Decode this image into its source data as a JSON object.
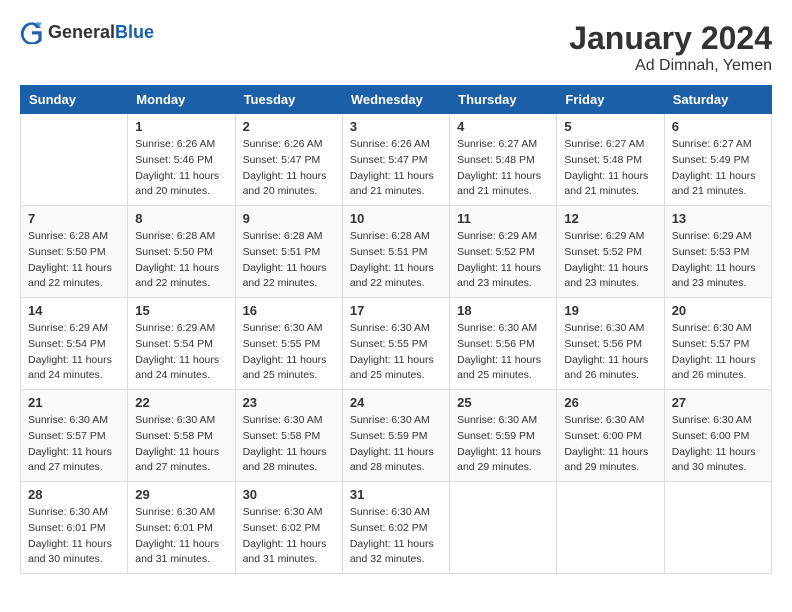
{
  "header": {
    "logo_general": "General",
    "logo_blue": "Blue",
    "month": "January 2024",
    "location": "Ad Dimnah, Yemen"
  },
  "days_of_week": [
    "Sunday",
    "Monday",
    "Tuesday",
    "Wednesday",
    "Thursday",
    "Friday",
    "Saturday"
  ],
  "weeks": [
    [
      {
        "day": "",
        "info": ""
      },
      {
        "day": "1",
        "info": "Sunrise: 6:26 AM\nSunset: 5:46 PM\nDaylight: 11 hours\nand 20 minutes."
      },
      {
        "day": "2",
        "info": "Sunrise: 6:26 AM\nSunset: 5:47 PM\nDaylight: 11 hours\nand 20 minutes."
      },
      {
        "day": "3",
        "info": "Sunrise: 6:26 AM\nSunset: 5:47 PM\nDaylight: 11 hours\nand 21 minutes."
      },
      {
        "day": "4",
        "info": "Sunrise: 6:27 AM\nSunset: 5:48 PM\nDaylight: 11 hours\nand 21 minutes."
      },
      {
        "day": "5",
        "info": "Sunrise: 6:27 AM\nSunset: 5:48 PM\nDaylight: 11 hours\nand 21 minutes."
      },
      {
        "day": "6",
        "info": "Sunrise: 6:27 AM\nSunset: 5:49 PM\nDaylight: 11 hours\nand 21 minutes."
      }
    ],
    [
      {
        "day": "7",
        "info": "Sunrise: 6:28 AM\nSunset: 5:50 PM\nDaylight: 11 hours\nand 22 minutes."
      },
      {
        "day": "8",
        "info": "Sunrise: 6:28 AM\nSunset: 5:50 PM\nDaylight: 11 hours\nand 22 minutes."
      },
      {
        "day": "9",
        "info": "Sunrise: 6:28 AM\nSunset: 5:51 PM\nDaylight: 11 hours\nand 22 minutes."
      },
      {
        "day": "10",
        "info": "Sunrise: 6:28 AM\nSunset: 5:51 PM\nDaylight: 11 hours\nand 22 minutes."
      },
      {
        "day": "11",
        "info": "Sunrise: 6:29 AM\nSunset: 5:52 PM\nDaylight: 11 hours\nand 23 minutes."
      },
      {
        "day": "12",
        "info": "Sunrise: 6:29 AM\nSunset: 5:52 PM\nDaylight: 11 hours\nand 23 minutes."
      },
      {
        "day": "13",
        "info": "Sunrise: 6:29 AM\nSunset: 5:53 PM\nDaylight: 11 hours\nand 23 minutes."
      }
    ],
    [
      {
        "day": "14",
        "info": "Sunrise: 6:29 AM\nSunset: 5:54 PM\nDaylight: 11 hours\nand 24 minutes."
      },
      {
        "day": "15",
        "info": "Sunrise: 6:29 AM\nSunset: 5:54 PM\nDaylight: 11 hours\nand 24 minutes."
      },
      {
        "day": "16",
        "info": "Sunrise: 6:30 AM\nSunset: 5:55 PM\nDaylight: 11 hours\nand 25 minutes."
      },
      {
        "day": "17",
        "info": "Sunrise: 6:30 AM\nSunset: 5:55 PM\nDaylight: 11 hours\nand 25 minutes."
      },
      {
        "day": "18",
        "info": "Sunrise: 6:30 AM\nSunset: 5:56 PM\nDaylight: 11 hours\nand 25 minutes."
      },
      {
        "day": "19",
        "info": "Sunrise: 6:30 AM\nSunset: 5:56 PM\nDaylight: 11 hours\nand 26 minutes."
      },
      {
        "day": "20",
        "info": "Sunrise: 6:30 AM\nSunset: 5:57 PM\nDaylight: 11 hours\nand 26 minutes."
      }
    ],
    [
      {
        "day": "21",
        "info": "Sunrise: 6:30 AM\nSunset: 5:57 PM\nDaylight: 11 hours\nand 27 minutes."
      },
      {
        "day": "22",
        "info": "Sunrise: 6:30 AM\nSunset: 5:58 PM\nDaylight: 11 hours\nand 27 minutes."
      },
      {
        "day": "23",
        "info": "Sunrise: 6:30 AM\nSunset: 5:58 PM\nDaylight: 11 hours\nand 28 minutes."
      },
      {
        "day": "24",
        "info": "Sunrise: 6:30 AM\nSunset: 5:59 PM\nDaylight: 11 hours\nand 28 minutes."
      },
      {
        "day": "25",
        "info": "Sunrise: 6:30 AM\nSunset: 5:59 PM\nDaylight: 11 hours\nand 29 minutes."
      },
      {
        "day": "26",
        "info": "Sunrise: 6:30 AM\nSunset: 6:00 PM\nDaylight: 11 hours\nand 29 minutes."
      },
      {
        "day": "27",
        "info": "Sunrise: 6:30 AM\nSunset: 6:00 PM\nDaylight: 11 hours\nand 30 minutes."
      }
    ],
    [
      {
        "day": "28",
        "info": "Sunrise: 6:30 AM\nSunset: 6:01 PM\nDaylight: 11 hours\nand 30 minutes."
      },
      {
        "day": "29",
        "info": "Sunrise: 6:30 AM\nSunset: 6:01 PM\nDaylight: 11 hours\nand 31 minutes."
      },
      {
        "day": "30",
        "info": "Sunrise: 6:30 AM\nSunset: 6:02 PM\nDaylight: 11 hours\nand 31 minutes."
      },
      {
        "day": "31",
        "info": "Sunrise: 6:30 AM\nSunset: 6:02 PM\nDaylight: 11 hours\nand 32 minutes."
      },
      {
        "day": "",
        "info": ""
      },
      {
        "day": "",
        "info": ""
      },
      {
        "day": "",
        "info": ""
      }
    ]
  ]
}
